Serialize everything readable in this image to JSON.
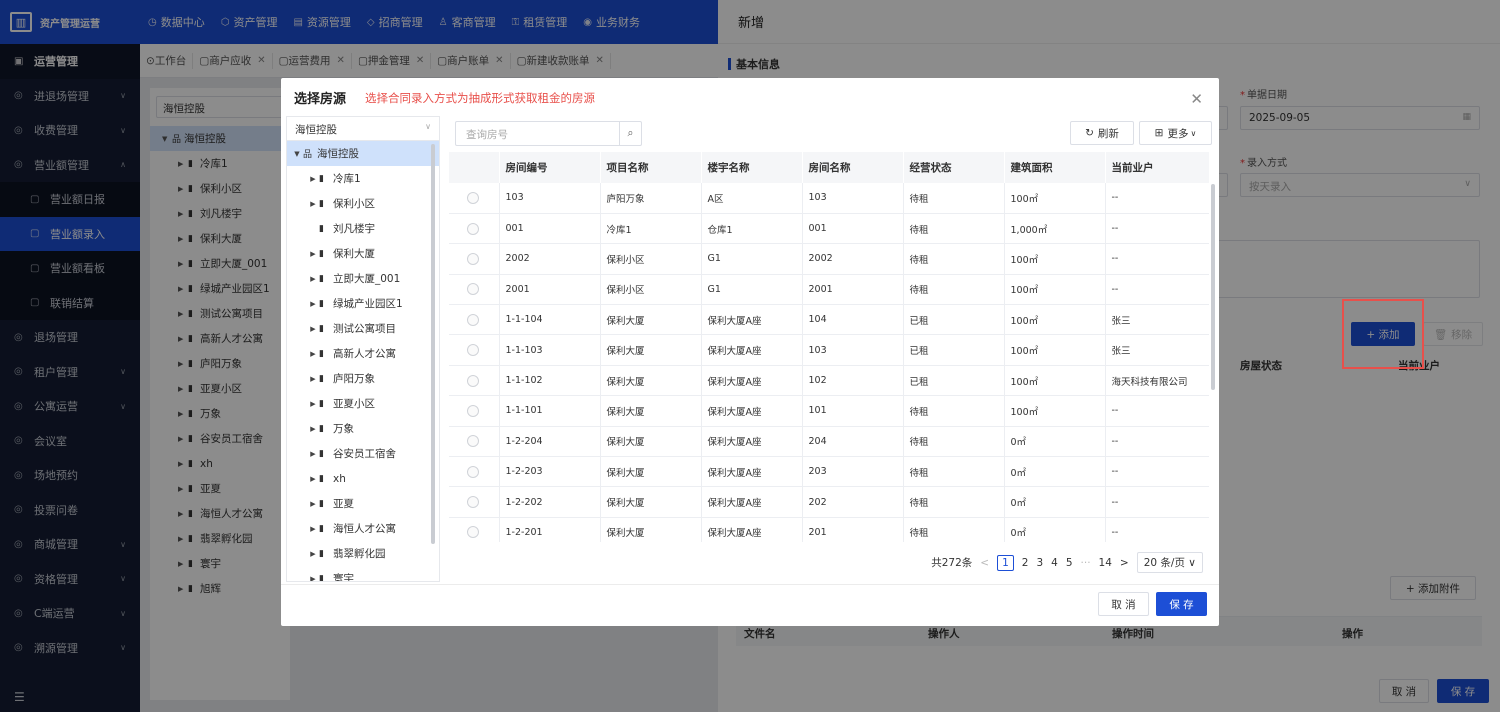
{
  "app": {
    "title": "资产管理运营"
  },
  "topnav": [
    {
      "label": "数据中心",
      "icon": "clock-icon"
    },
    {
      "label": "资产管理",
      "icon": "cube-icon"
    },
    {
      "label": "资源管理",
      "icon": "doc-icon"
    },
    {
      "label": "招商管理",
      "icon": "tag-icon"
    },
    {
      "label": "客商管理",
      "icon": "user-icon"
    },
    {
      "label": "租赁管理",
      "icon": "key-icon"
    },
    {
      "label": "业务财务",
      "icon": "money-icon"
    }
  ],
  "sidebar": {
    "head": "运营管理",
    "items": [
      {
        "label": "进退场管理",
        "sub": false
      },
      {
        "label": "收费管理",
        "sub": false
      },
      {
        "label": "营业额管理",
        "sub": false,
        "open": true
      },
      {
        "label": "营业额日报",
        "sub": true
      },
      {
        "label": "营业额录入",
        "sub": true,
        "active": true
      },
      {
        "label": "营业额看板",
        "sub": true
      },
      {
        "label": "联销结算",
        "sub": true
      },
      {
        "label": "退场管理",
        "sub": false
      },
      {
        "label": "租户管理",
        "sub": false
      },
      {
        "label": "公寓运营",
        "sub": false
      },
      {
        "label": "会议室",
        "sub": false
      },
      {
        "label": "场地预约",
        "sub": false
      },
      {
        "label": "投票问卷",
        "sub": false
      },
      {
        "label": "商城管理",
        "sub": false
      },
      {
        "label": "资格管理",
        "sub": false
      },
      {
        "label": "C端运营",
        "sub": false
      },
      {
        "label": "溯源管理",
        "sub": false
      }
    ]
  },
  "tabs": [
    "工作台",
    "商户应收",
    "运营费用",
    "押金管理",
    "商户账单",
    "新建收款账单"
  ],
  "bg_tree": {
    "select": "海恒控股",
    "root": "海恒控股",
    "nodes": [
      "冷库1",
      "保利小区",
      "刘凡楼宇",
      "保利大厦",
      "立即大厦_001",
      "绿城产业园区1",
      "测试公寓项目",
      "高新人才公寓",
      "庐阳万象",
      "亚夏小区",
      "万象",
      "谷安员工宿舍",
      "xh",
      "亚夏",
      "海恒人才公寓",
      "翡翠孵化园",
      "寰宇",
      "旭辉"
    ]
  },
  "drawer": {
    "title": "新增",
    "section": "基本信息",
    "date_label": "单据日期",
    "date_value": "2025-09-05",
    "mode_label": "录入方式",
    "mode_placeholder": "按天录入",
    "add_button": "+ 添加",
    "remove_button": "移除",
    "col_status": "房屋状态",
    "col_tenant": "当前业户",
    "add_attachment": "+ 添加附件",
    "att_cols": [
      "文件名",
      "操作人",
      "操作时间",
      "操作"
    ],
    "cancel": "取 消",
    "save": "保 存"
  },
  "modal": {
    "title": "选择房源",
    "hint": "选择合同录入方式为抽成形式获取租金的房源",
    "tree_select": "海恒控股",
    "tree_root": "海恒控股",
    "tree_nodes": [
      {
        "label": "冷库1",
        "arrow": true
      },
      {
        "label": "保利小区",
        "arrow": true
      },
      {
        "label": "刘凡楼宇",
        "arrow": false
      },
      {
        "label": "保利大厦",
        "arrow": true
      },
      {
        "label": "立即大厦_001",
        "arrow": true
      },
      {
        "label": "绿城产业园区1",
        "arrow": true
      },
      {
        "label": "测试公寓项目",
        "arrow": true
      },
      {
        "label": "高新人才公寓",
        "arrow": true
      },
      {
        "label": "庐阳万象",
        "arrow": true
      },
      {
        "label": "亚夏小区",
        "arrow": true
      },
      {
        "label": "万象",
        "arrow": true
      },
      {
        "label": "谷安员工宿舍",
        "arrow": true
      },
      {
        "label": "xh",
        "arrow": true
      },
      {
        "label": "亚夏",
        "arrow": true
      },
      {
        "label": "海恒人才公寓",
        "arrow": true
      },
      {
        "label": "翡翠孵化园",
        "arrow": true
      },
      {
        "label": "寰宇",
        "arrow": true
      }
    ],
    "search_placeholder": "查询房号",
    "refresh": "刷新",
    "more": "更多",
    "columns": [
      "",
      "房间编号",
      "项目名称",
      "楼宇名称",
      "房间名称",
      "经营状态",
      "建筑面积",
      "当前业户"
    ],
    "rows": [
      [
        "103",
        "庐阳万象",
        "A区",
        "103",
        "待租",
        "100㎡",
        "--"
      ],
      [
        "001",
        "冷库1",
        "仓库1",
        "001",
        "待租",
        "1,000㎡",
        "--"
      ],
      [
        "2002",
        "保利小区",
        "G1",
        "2002",
        "待租",
        "100㎡",
        "--"
      ],
      [
        "2001",
        "保利小区",
        "G1",
        "2001",
        "待租",
        "100㎡",
        "--"
      ],
      [
        "1-1-104",
        "保利大厦",
        "保利大厦A座",
        "104",
        "已租",
        "100㎡",
        "张三"
      ],
      [
        "1-1-103",
        "保利大厦",
        "保利大厦A座",
        "103",
        "已租",
        "100㎡",
        "张三"
      ],
      [
        "1-1-102",
        "保利大厦",
        "保利大厦A座",
        "102",
        "已租",
        "100㎡",
        "海天科技有限公司"
      ],
      [
        "1-1-101",
        "保利大厦",
        "保利大厦A座",
        "101",
        "待租",
        "100㎡",
        "--"
      ],
      [
        "1-2-204",
        "保利大厦",
        "保利大厦A座",
        "204",
        "待租",
        "0㎡",
        "--"
      ],
      [
        "1-2-203",
        "保利大厦",
        "保利大厦A座",
        "203",
        "待租",
        "0㎡",
        "--"
      ],
      [
        "1-2-202",
        "保利大厦",
        "保利大厦A座",
        "202",
        "待租",
        "0㎡",
        "--"
      ],
      [
        "1-2-201",
        "保利大厦",
        "保利大厦A座",
        "201",
        "待租",
        "0㎡",
        "--"
      ]
    ],
    "pager": {
      "total": "共272条",
      "pages": [
        "1",
        "2",
        "3",
        "4",
        "5"
      ],
      "ellipsis": "···",
      "last": "14",
      "size": "20 条/页"
    },
    "cancel": "取 消",
    "save": "保 存"
  }
}
